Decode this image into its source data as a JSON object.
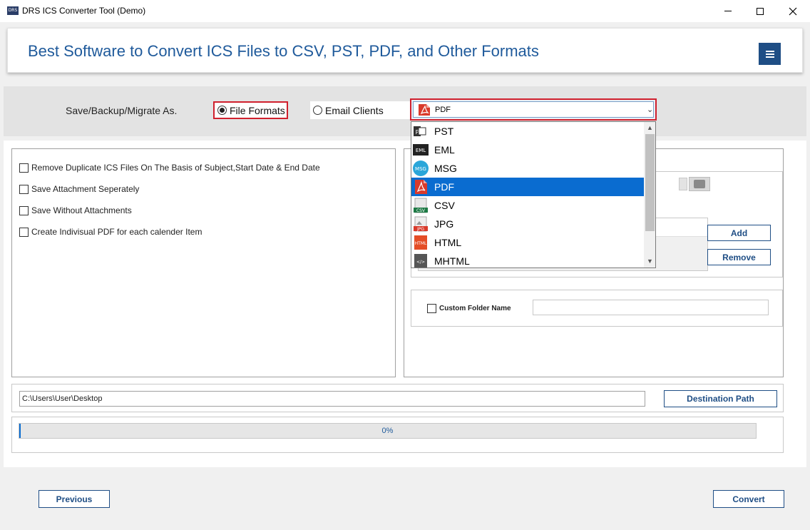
{
  "window": {
    "title": "DRS ICS Converter Tool (Demo)",
    "icon_text": "DRS"
  },
  "banner": {
    "title": "Best Software to Convert ICS Files to CSV, PST, PDF, and Other Formats"
  },
  "save": {
    "label": "Save/Backup/Migrate As.",
    "radio_file_formats": "File Formats",
    "radio_email_clients": "Email Clients",
    "selected_radio": "File Formats",
    "selected_format": "PDF",
    "format_options": [
      {
        "label": "PST",
        "icon": "pst-icon",
        "color": "#333333"
      },
      {
        "label": "EML",
        "icon": "eml-icon",
        "color": "#222222"
      },
      {
        "label": "MSG",
        "icon": "msg-icon",
        "color": "#2aa6d9"
      },
      {
        "label": "PDF",
        "icon": "pdf-icon",
        "color": "#d93a2b",
        "selected": true
      },
      {
        "label": "CSV",
        "icon": "csv-icon",
        "color": "#1e7a45"
      },
      {
        "label": "JPG",
        "icon": "jpg-icon",
        "color": "#d93a2b"
      },
      {
        "label": "HTML",
        "icon": "html-icon",
        "color": "#e44d26"
      },
      {
        "label": "MHTML",
        "icon": "mhtml-icon",
        "color": "#555555"
      }
    ]
  },
  "options": {
    "items": [
      "Remove Duplicate ICS Files On The Basis of Subject,Start Date & End Date",
      "Save Attachment Seperately",
      "Save Without Attachments",
      "Create Indivisual PDF for each calender Item"
    ]
  },
  "right_panel": {
    "add_label": "Add",
    "remove_label": "Remove",
    "custom_folder_label": "Custom Folder Name"
  },
  "destination": {
    "path_value": "C:\\Users\\User\\Desktop",
    "button_label": "Destination Path"
  },
  "progress": {
    "value": 0,
    "text": "0%"
  },
  "footer": {
    "previous_label": "Previous",
    "convert_label": "Convert"
  },
  "colors": {
    "accent": "#1f4e85",
    "title_blue": "#1f5a9b",
    "highlight_red": "#d0202d",
    "selection_blue": "#0a6cd0"
  }
}
